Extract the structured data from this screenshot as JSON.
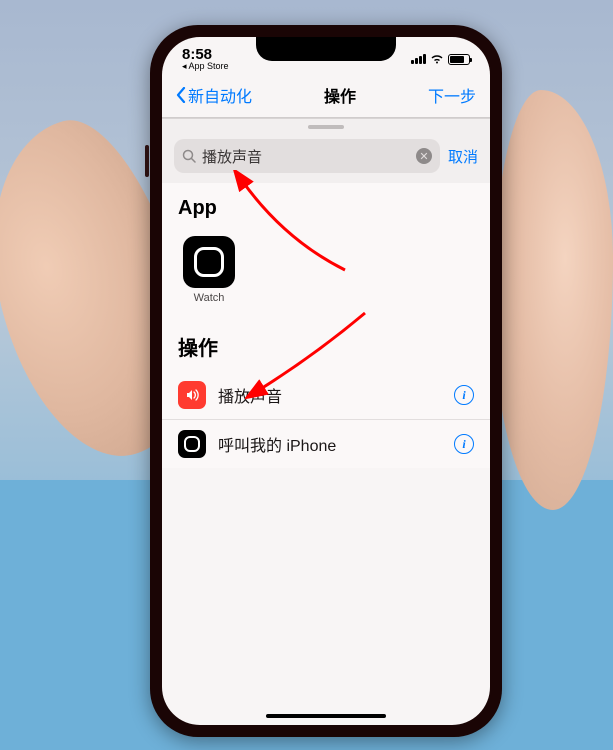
{
  "status": {
    "time": "8:58",
    "sub": "◂ App Store"
  },
  "nav": {
    "back": "新自动化",
    "title": "操作",
    "next": "下一步"
  },
  "search": {
    "value": "播放声音",
    "cancel": "取消"
  },
  "sections": {
    "app": "App",
    "actions": "操作"
  },
  "app": {
    "watch": "Watch"
  },
  "actions": [
    {
      "label": "播放声音",
      "icon": "speaker",
      "color": "red"
    },
    {
      "label": "呼叫我的 iPhone",
      "icon": "watch",
      "color": "black"
    }
  ]
}
